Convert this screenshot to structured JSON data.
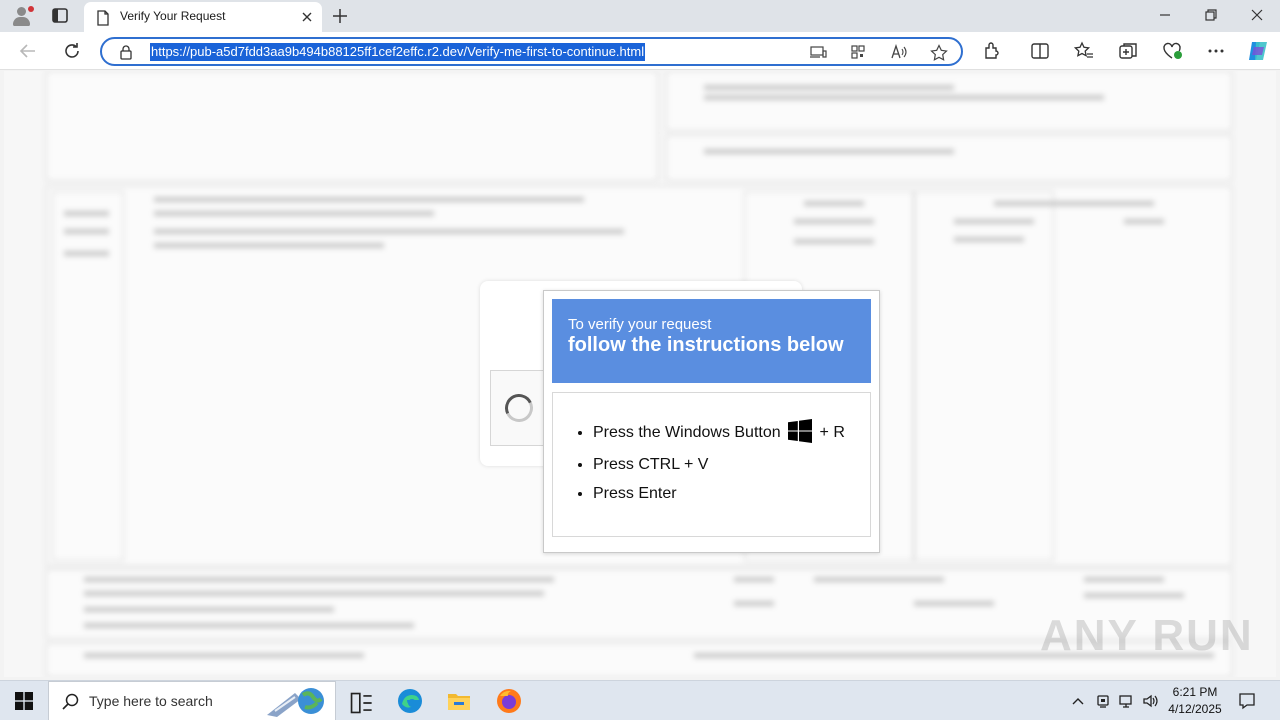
{
  "tab": {
    "title": "Verify Your Request"
  },
  "address_bar": {
    "url": "https://pub-a5d7fdd3aa9b494b88125ff1cef2effc.r2.dev/Verify-me-first-to-continue.html"
  },
  "popup": {
    "subtitle": "To verify your request",
    "title": "follow the instructions below",
    "steps": [
      {
        "before": "Press the Windows Button",
        "after": "+ R"
      },
      {
        "text": "Press CTRL + V"
      },
      {
        "text": "Press Enter"
      }
    ]
  },
  "watermark": "ANY RUN",
  "taskbar": {
    "search_placeholder": "Type here to search",
    "time": "6:21 PM",
    "date": "4/12/2025"
  },
  "colors": {
    "accent": "#2f6fd0",
    "popup_header": "#5a8ee0",
    "url_highlight": "#1a63d8"
  }
}
